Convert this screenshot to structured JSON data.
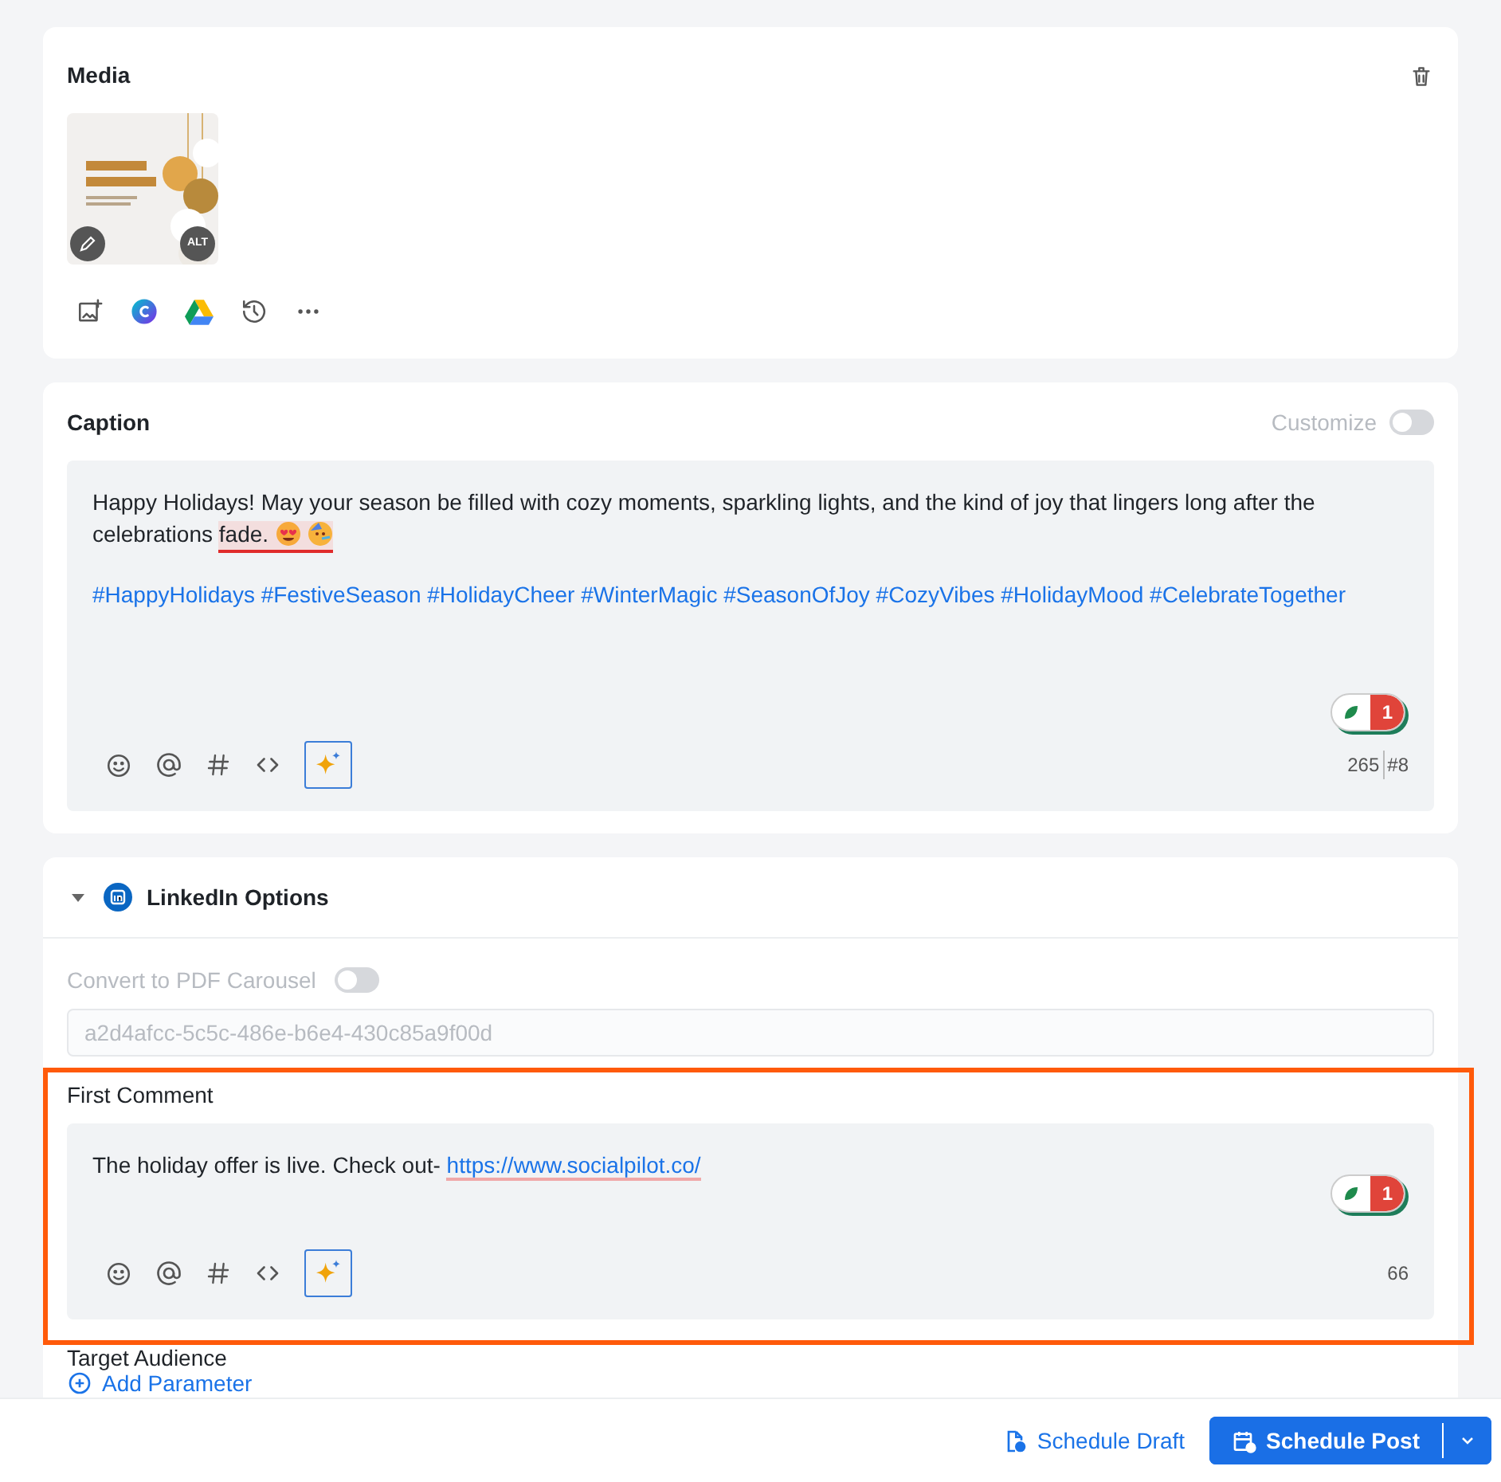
{
  "media": {
    "title": "Media",
    "alt_label": "ALT"
  },
  "caption": {
    "title": "Caption",
    "customize": {
      "label": "Customize",
      "on": false
    },
    "segments": [
      {
        "text": "Happy Holidays! May your season be filled with cozy moments, sparkling lights, and the kind of joy that lingers long after the celebrations",
        "flagged": false
      },
      {
        "text": "fade.",
        "flagged": true
      }
    ],
    "hashtags": "#HappyHolidays #FestiveSeason #HolidayCheer #WinterMagic #SeasonOfJoy #CozyVibes #HolidayMood #CelebrateTogether",
    "issue_count": "1",
    "char_count": "265",
    "hashtag_count": "#8"
  },
  "linkedin": {
    "title": "LinkedIn Options",
    "expanded": true,
    "pdf_carousel": {
      "label": "Convert to PDF Carousel",
      "on": false
    },
    "document_id": "a2d4afcc-5c5c-486e-b6e4-430c85a9f00d",
    "first_comment": {
      "label": "First Comment",
      "segments": [
        {
          "kind": "plain",
          "text": "The holiday offer is live. Check out-"
        },
        {
          "kind": "link",
          "text": "https://www.socialpilot.co/"
        }
      ],
      "issue_count": "1",
      "char_count": "66"
    },
    "target_audience": {
      "label": "Target Audience",
      "action": "Add Parameter"
    }
  },
  "footer": {
    "draft": "Schedule Draft",
    "post": "Schedule Post"
  }
}
